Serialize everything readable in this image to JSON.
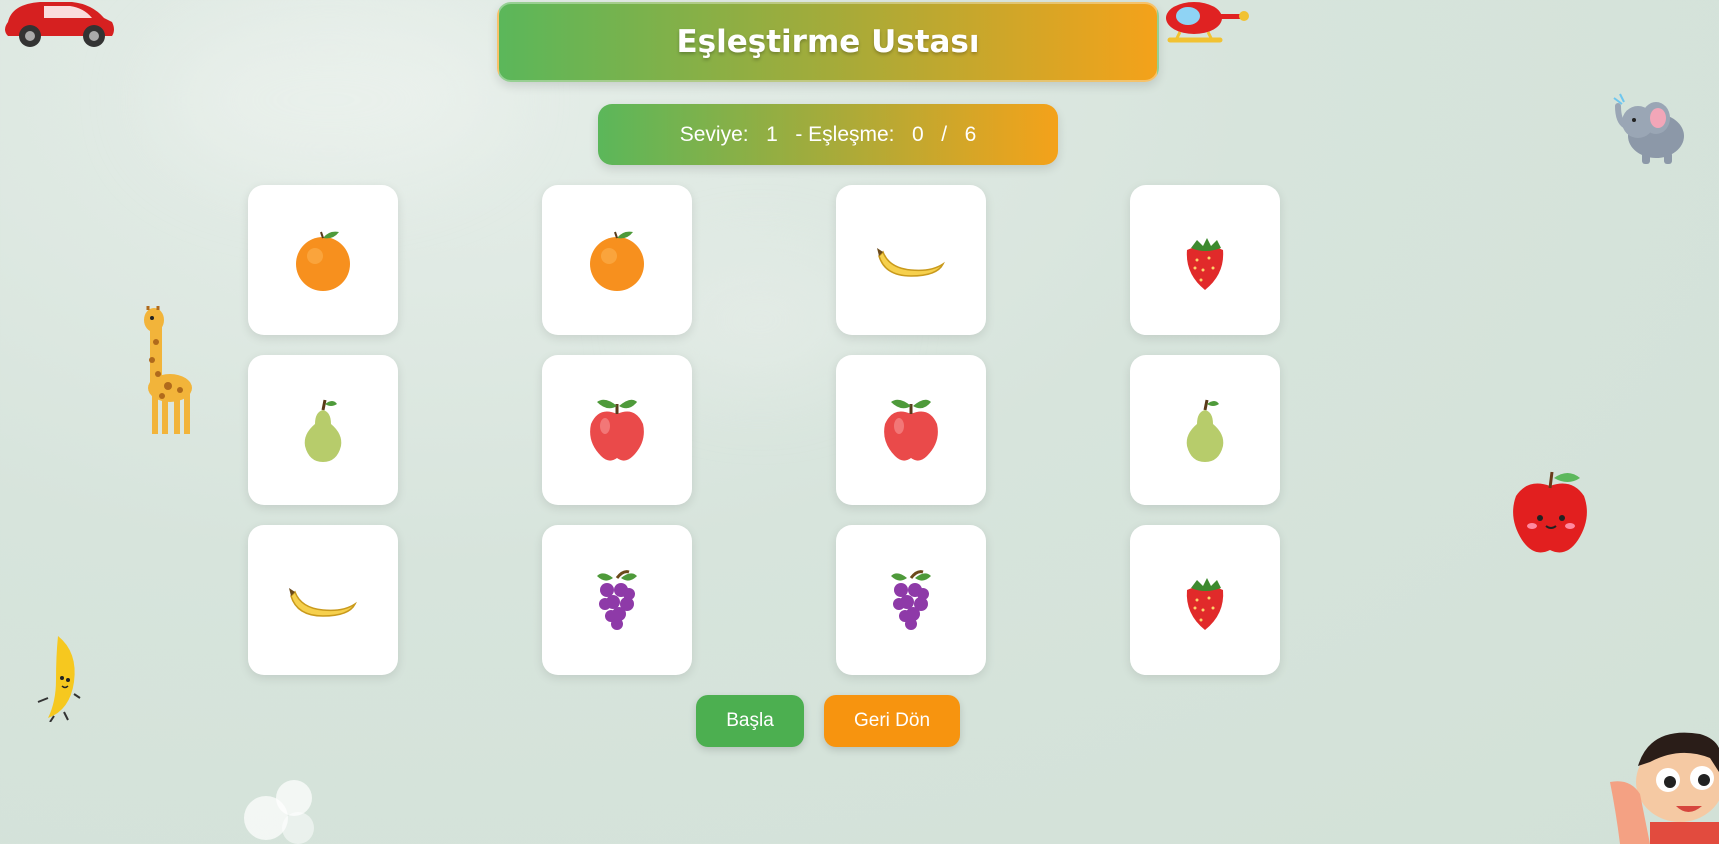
{
  "game": {
    "title": "Eşleştirme Ustası"
  },
  "status": {
    "level_label": "Seviye:",
    "level_value": "1",
    "match_label": "- Eşleşme:",
    "matched": "0",
    "separator": "/",
    "total": "6"
  },
  "cards": [
    {
      "fruit": "orange-icon"
    },
    {
      "fruit": "orange-icon"
    },
    {
      "fruit": "banana-icon"
    },
    {
      "fruit": "strawberry-icon"
    },
    {
      "fruit": "pear-icon"
    },
    {
      "fruit": "apple-icon"
    },
    {
      "fruit": "apple-icon"
    },
    {
      "fruit": "pear-icon"
    },
    {
      "fruit": "banana-icon"
    },
    {
      "fruit": "grapes-icon"
    },
    {
      "fruit": "grapes-icon"
    },
    {
      "fruit": "strawberry-icon"
    }
  ],
  "buttons": {
    "start_label": "Başla",
    "back_label": "Geri Dön"
  },
  "colors": {
    "gradient_start": "#5bb75a",
    "gradient_end": "#f4a21a",
    "start_button": "#4caf50",
    "back_button": "#f7940f"
  },
  "decorations": [
    "car-icon",
    "helicopter-icon",
    "elephant-icon",
    "giraffe-icon",
    "apple-character-icon",
    "banana-character-icon",
    "boy-character-icon",
    "cloud-icon"
  ]
}
